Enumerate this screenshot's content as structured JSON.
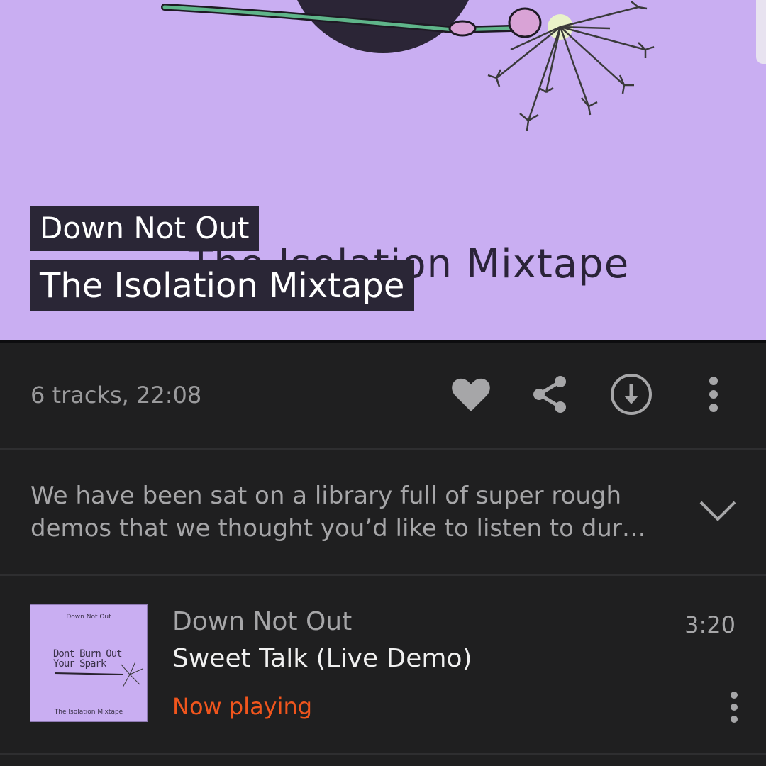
{
  "album": {
    "artist": "Down Not Out",
    "title": "The Isolation Mixtape",
    "art_subtitle": "The Isolation Mixtape",
    "art_background": "#c9aef2"
  },
  "info": {
    "summary": "6 tracks, 22:08",
    "actions": [
      "heart-icon",
      "share-icon",
      "download-icon",
      "more-vertical-icon"
    ]
  },
  "description": {
    "text": "We have been sat on a library full of super rough demos that we thought you’d like to listen to dur…"
  },
  "tracks": [
    {
      "artist": "Down Not Out",
      "title": "Sweet Talk (Live Demo)",
      "status": "Now playing",
      "duration": "3:20",
      "thumb": {
        "top": "Down Not Out",
        "mid": "Dont Burn Out\nYour Spark",
        "bottom": "The Isolation Mixtape"
      }
    }
  ],
  "colors": {
    "accent": "#f0551d",
    "background": "#1f1f20"
  }
}
